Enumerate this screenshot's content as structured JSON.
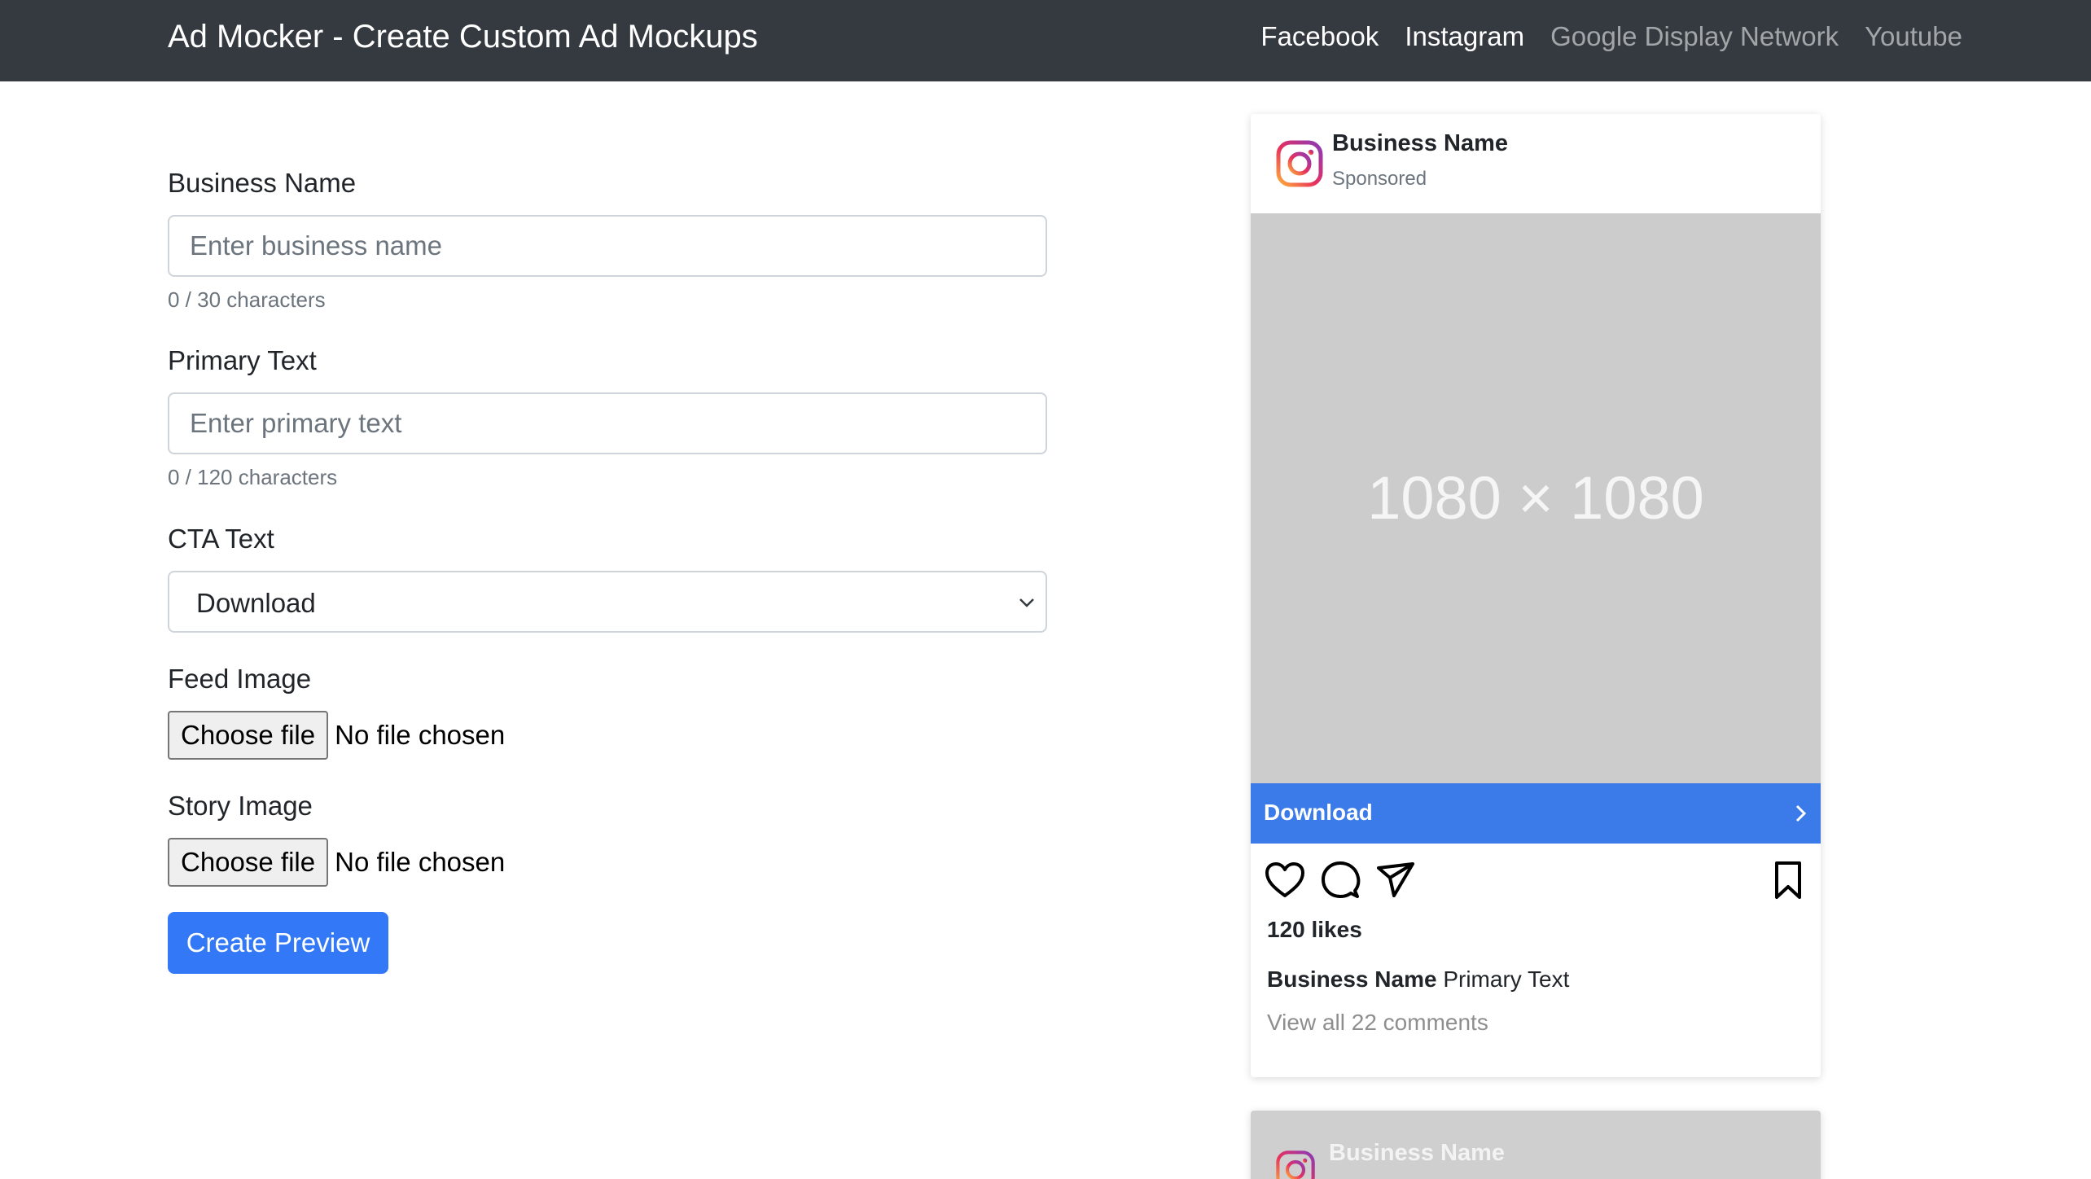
{
  "navbar": {
    "brand": "Ad Mocker - Create Custom Ad Mockups",
    "links": [
      {
        "label": "Facebook",
        "active": true
      },
      {
        "label": "Instagram",
        "active": true
      },
      {
        "label": "Google Display Network",
        "active": false
      },
      {
        "label": "Youtube",
        "active": false
      }
    ]
  },
  "form": {
    "business_name": {
      "label": "Business Name",
      "placeholder": "Enter business name",
      "value": "",
      "counter": "0 / 30 characters"
    },
    "primary_text": {
      "label": "Primary Text",
      "placeholder": "Enter primary text",
      "value": "",
      "counter": "0 / 120 characters"
    },
    "cta_text": {
      "label": "CTA Text",
      "selected": "Download"
    },
    "feed_image": {
      "label": "Feed Image",
      "button": "Choose file",
      "status": "No file chosen"
    },
    "story_image": {
      "label": "Story Image",
      "button": "Choose file",
      "status": "No file chosen"
    },
    "submit_label": "Create Preview"
  },
  "preview": {
    "business_name": "Business Name",
    "sponsored": "Sponsored",
    "image_placeholder": "1080 × 1080",
    "cta_label": "Download",
    "likes": "120 likes",
    "caption_name": "Business Name",
    "caption_text": "Primary Text",
    "comments": "View all 22 comments",
    "icons": [
      "heart-icon",
      "comment-icon",
      "share-icon",
      "bookmark-icon"
    ]
  },
  "story_preview": {
    "business_name": "Business Name"
  },
  "colors": {
    "navbar_bg": "#343a40",
    "primary": "#3378f6",
    "cta_bar": "#3b7be9",
    "placeholder_bg": "#cccccc"
  }
}
